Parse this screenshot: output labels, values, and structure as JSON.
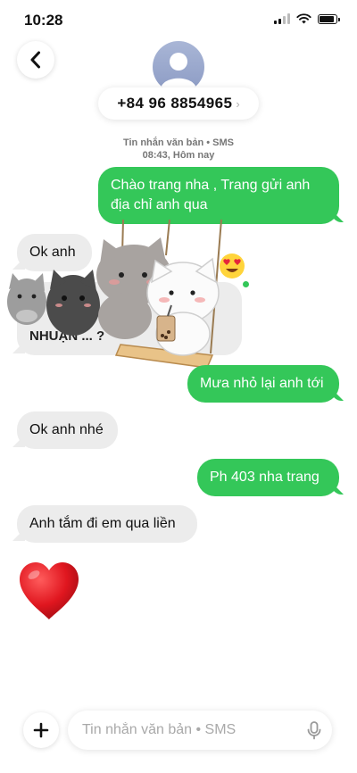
{
  "status_bar": {
    "time": "10:28",
    "battery_level": 0.9
  },
  "header": {
    "phone_number": "+84 96 8854965",
    "chevron": "›"
  },
  "thread": {
    "label": "Tin nhắn văn bản • SMS",
    "timestamp": "08:43, Hôm nay"
  },
  "messages": [
    {
      "direction": "outgoing",
      "text": "Chào trang nha , Trang gửi anh địa chỉ anh qua"
    },
    {
      "direction": "incoming",
      "text": "Ok anh"
    },
    {
      "direction": "incoming",
      "text": "NHUẬN ... ?",
      "note": "partially covered by sticker"
    },
    {
      "direction": "outgoing",
      "text": "Mưa nhỏ lại anh tới"
    },
    {
      "direction": "incoming",
      "text": "Ok anh nhé"
    },
    {
      "direction": "outgoing",
      "text": "Ph 403 nha trang"
    },
    {
      "direction": "incoming",
      "text": "Anh tắm đi em qua liền"
    }
  ],
  "reaction": {
    "icon": "heart-eyes-emoji-icon"
  },
  "heart": {
    "icon": "red-heart-icon",
    "color": "#e0161f"
  },
  "composer": {
    "placeholder": "Tin nhắn văn bản • SMS",
    "value": ""
  },
  "colors": {
    "outgoing": "#34c759",
    "incoming": "#ececec",
    "accent": "#34c759"
  }
}
